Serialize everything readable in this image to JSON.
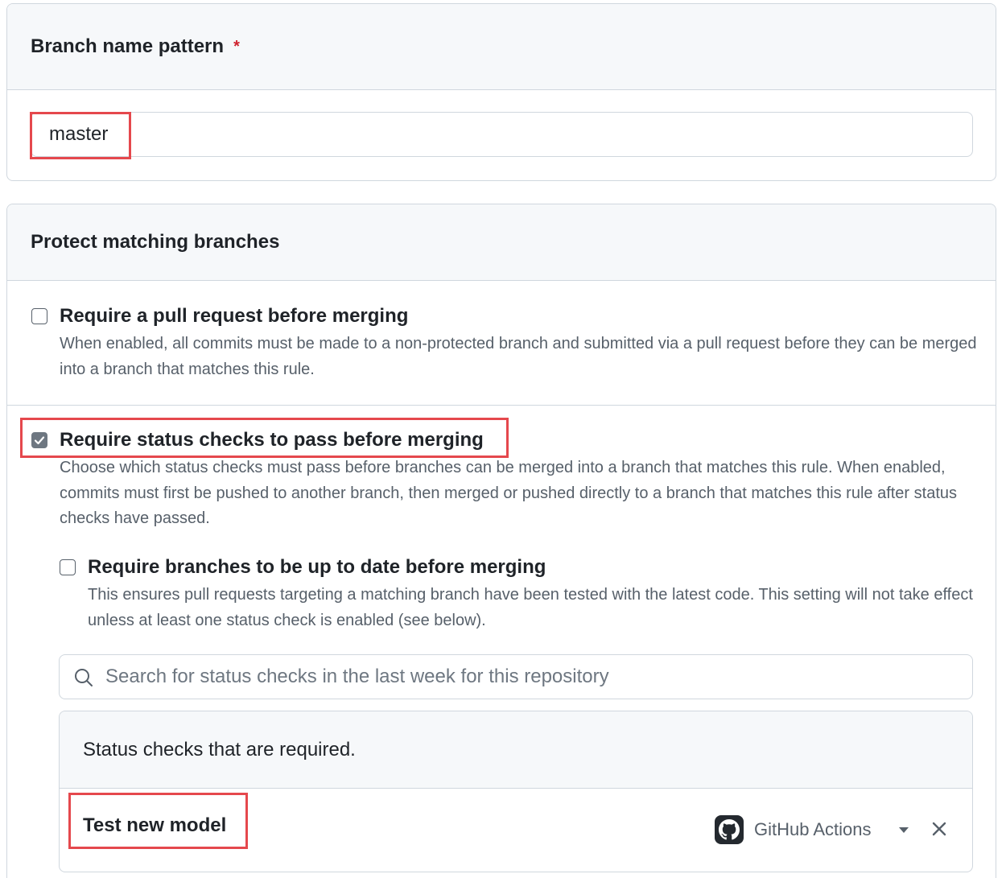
{
  "branch_pattern": {
    "header": "Branch name pattern",
    "required_marker": "*",
    "input_value": "master"
  },
  "protect": {
    "header": "Protect matching branches",
    "options": [
      {
        "title": "Require a pull request before merging",
        "description": "When enabled, all commits must be made to a non-protected branch and submitted via a pull request before they can be merged into a branch that matches this rule.",
        "checked": false
      },
      {
        "title": "Require status checks to pass before merging",
        "description": "Choose which status checks must pass before branches can be merged into a branch that matches this rule. When enabled, commits must first be pushed to another branch, then merged or pushed directly to a branch that matches this rule after status checks have passed.",
        "checked": true
      }
    ],
    "sub_option": {
      "title": "Require branches to be up to date before merging",
      "description": "This ensures pull requests targeting a matching branch have been tested with the latest code. This setting will not take effect unless at least one status check is enabled (see below).",
      "checked": false
    },
    "search": {
      "placeholder": "Search for status checks in the last week for this repository"
    },
    "required_checks": {
      "header": "Status checks that are required.",
      "items": [
        {
          "name": "Test new model",
          "source": "GitHub Actions"
        }
      ]
    }
  },
  "icons": {
    "search": "search-icon",
    "github": "github-logo-icon",
    "dropdown": "caret-down-icon",
    "remove": "close-icon",
    "check": "checkmark-icon"
  },
  "colors": {
    "highlight": "#e5484d",
    "required_star": "#cf222e",
    "header_bg": "#f6f8fa",
    "border": "#d0d7de"
  }
}
